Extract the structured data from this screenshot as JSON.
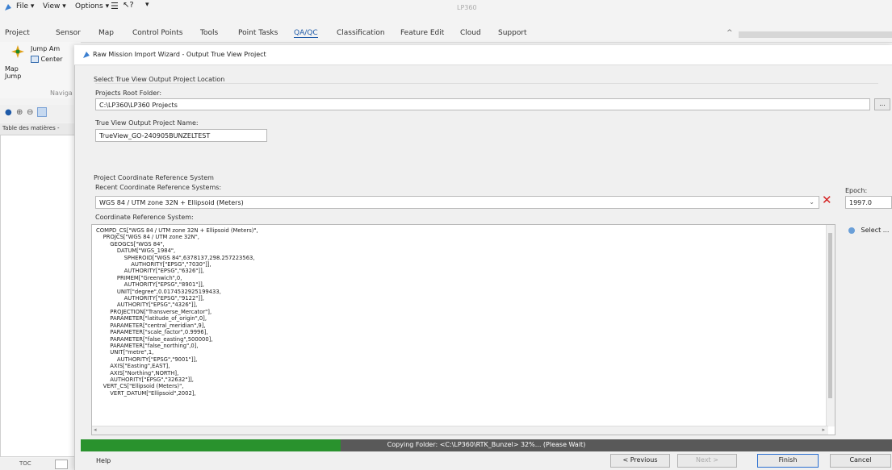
{
  "app": {
    "title": "LP360",
    "quick_menu": [
      "File",
      "View",
      "Options"
    ],
    "tabs": [
      "Project",
      "Sensor",
      "Map",
      "Control Points",
      "Tools",
      "Point Tasks",
      "QA/QC",
      "Classification",
      "Feature Edit",
      "Cloud",
      "Support"
    ],
    "active_tab": "QA/QC",
    "ribbon": {
      "jump_label": "Jump Am",
      "center_label": "Center",
      "map_jump_label": "Map\nJump",
      "navigate_label": "Naviga"
    },
    "toc_header": "Table des matières - ",
    "status_left": "TOC"
  },
  "dialog": {
    "title": "Raw Mission Import Wizard - Output True View Project",
    "section_output_location": "Select True View Output Project Location",
    "projects_root_label": "Projects Root Folder:",
    "projects_root_value": "C:\\LP360\\LP360 Projects",
    "browse_label": "...",
    "project_name_label": "True View Output Project Name:",
    "project_name_value": "TrueView_GO-240905BUNZELTEST",
    "section_crs": "Project Coordinate Reference System",
    "recent_crs_label": "Recent Coordinate Reference Systems:",
    "recent_crs_value": "WGS 84 / UTM zone 32N + Ellipsoid (Meters)",
    "epoch_label": "Epoch:",
    "epoch_value": "1997.0",
    "crs_label": "Coordinate Reference System:",
    "select_label": "Select ...",
    "crs_wkt": "COMPD_CS[\"WGS 84 / UTM zone 32N + Ellipsoid (Meters)\",\n    PROJCS[\"WGS 84 / UTM zone 32N\",\n        GEOGCS[\"WGS 84\",\n            DATUM[\"WGS_1984\",\n                SPHEROID[\"WGS 84\",6378137,298.257223563,\n                    AUTHORITY[\"EPSG\",\"7030\"]],\n                AUTHORITY[\"EPSG\",\"6326\"]],\n            PRIMEM[\"Greenwich\",0,\n                AUTHORITY[\"EPSG\",\"8901\"]],\n            UNIT[\"degree\",0.0174532925199433,\n                AUTHORITY[\"EPSG\",\"9122\"]],\n            AUTHORITY[\"EPSG\",\"4326\"]],\n        PROJECTION[\"Transverse_Mercator\"],\n        PARAMETER[\"latitude_of_origin\",0],\n        PARAMETER[\"central_meridian\",9],\n        PARAMETER[\"scale_factor\",0.9996],\n        PARAMETER[\"false_easting\",500000],\n        PARAMETER[\"false_northing\",0],\n        UNIT[\"metre\",1,\n            AUTHORITY[\"EPSG\",\"9001\"]],\n        AXIS[\"Easting\",EAST],\n        AXIS[\"Northing\",NORTH],\n        AUTHORITY[\"EPSG\",\"32632\"]],\n    VERT_CS[\"Ellipsoid (Meters)\",\n        VERT_DATUM[\"Ellipsoid\",2002],",
    "progress_text": "Copying Folder: <C:\\LP360\\RTK_Bunzel> 32%... (Please Wait)",
    "progress_fraction": 0.32,
    "buttons": {
      "help": "Help",
      "previous": "< Previous",
      "next": "Next >",
      "finish": "Finish",
      "cancel": "Cancel"
    }
  },
  "colors": {
    "progress_fill": "#29922d",
    "progress_track": "#595959",
    "active_tab": "#1e5aa8",
    "clear_x": "#d42020",
    "finish_border": "#2a6fd1"
  }
}
